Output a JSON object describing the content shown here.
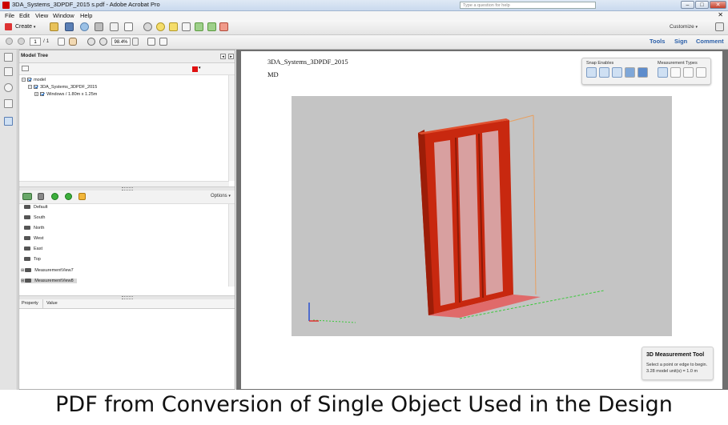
{
  "window": {
    "title": "3DA_Systems_3DPDF_2015 s.pdf - Adobe Acrobat Pro",
    "search_placeholder": "Type a question for help",
    "minimize": "–",
    "maximize": "□",
    "close": "✕"
  },
  "menu": [
    "File",
    "Edit",
    "View",
    "Window",
    "Help"
  ],
  "menu_close": "✕",
  "toolbar": {
    "create_label": "Create",
    "customize_label": "Customize"
  },
  "nav": {
    "page_current": "1",
    "page_total": "/ 1",
    "zoom": "98.4%",
    "tools": "Tools",
    "sign": "Sign",
    "comment": "Comment"
  },
  "model_tree": {
    "title": "Model Tree",
    "nodes": [
      {
        "label": "model"
      },
      {
        "label": "3DA_Systems_3DPDF_2015"
      },
      {
        "label": "Windows / 1.80m x 1.25m"
      }
    ]
  },
  "views": {
    "options_label": "Options",
    "items": [
      "Default",
      "South",
      "North",
      "West",
      "East",
      "Top",
      "MeasurementView7",
      "MeasurementView8"
    ]
  },
  "properties": {
    "col_property": "Property",
    "col_value": "Value"
  },
  "document": {
    "title": "3DA_Systems_3DPDF_2015",
    "subtitle": "MD"
  },
  "snap_panel": {
    "snap_label": "Snap Enables",
    "types_label": "Measurement Types"
  },
  "measure_tool": {
    "heading": "3D Measurement Tool",
    "line1": "Select a point or edge to begin.",
    "line2": "3.28 model unit(s) = 1.0 m"
  },
  "colors": {
    "frame_red": "#c8280f",
    "canvas_gray": "#c4c4c4",
    "link_blue": "#2a5ea8"
  },
  "caption": "PDF from Conversion of Single Object Used in the Design"
}
